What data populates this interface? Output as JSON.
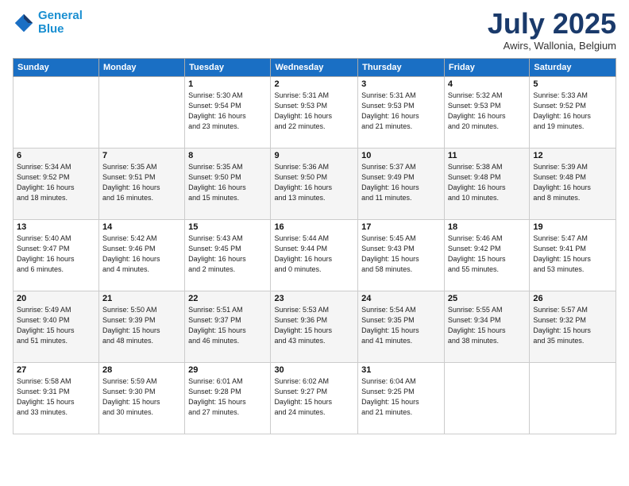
{
  "header": {
    "logo_line1": "General",
    "logo_line2": "Blue",
    "month": "July 2025",
    "location": "Awirs, Wallonia, Belgium"
  },
  "weekdays": [
    "Sunday",
    "Monday",
    "Tuesday",
    "Wednesday",
    "Thursday",
    "Friday",
    "Saturday"
  ],
  "weeks": [
    [
      {
        "day": "",
        "info": ""
      },
      {
        "day": "",
        "info": ""
      },
      {
        "day": "1",
        "info": "Sunrise: 5:30 AM\nSunset: 9:54 PM\nDaylight: 16 hours\nand 23 minutes."
      },
      {
        "day": "2",
        "info": "Sunrise: 5:31 AM\nSunset: 9:53 PM\nDaylight: 16 hours\nand 22 minutes."
      },
      {
        "day": "3",
        "info": "Sunrise: 5:31 AM\nSunset: 9:53 PM\nDaylight: 16 hours\nand 21 minutes."
      },
      {
        "day": "4",
        "info": "Sunrise: 5:32 AM\nSunset: 9:53 PM\nDaylight: 16 hours\nand 20 minutes."
      },
      {
        "day": "5",
        "info": "Sunrise: 5:33 AM\nSunset: 9:52 PM\nDaylight: 16 hours\nand 19 minutes."
      }
    ],
    [
      {
        "day": "6",
        "info": "Sunrise: 5:34 AM\nSunset: 9:52 PM\nDaylight: 16 hours\nand 18 minutes."
      },
      {
        "day": "7",
        "info": "Sunrise: 5:35 AM\nSunset: 9:51 PM\nDaylight: 16 hours\nand 16 minutes."
      },
      {
        "day": "8",
        "info": "Sunrise: 5:35 AM\nSunset: 9:50 PM\nDaylight: 16 hours\nand 15 minutes."
      },
      {
        "day": "9",
        "info": "Sunrise: 5:36 AM\nSunset: 9:50 PM\nDaylight: 16 hours\nand 13 minutes."
      },
      {
        "day": "10",
        "info": "Sunrise: 5:37 AM\nSunset: 9:49 PM\nDaylight: 16 hours\nand 11 minutes."
      },
      {
        "day": "11",
        "info": "Sunrise: 5:38 AM\nSunset: 9:48 PM\nDaylight: 16 hours\nand 10 minutes."
      },
      {
        "day": "12",
        "info": "Sunrise: 5:39 AM\nSunset: 9:48 PM\nDaylight: 16 hours\nand 8 minutes."
      }
    ],
    [
      {
        "day": "13",
        "info": "Sunrise: 5:40 AM\nSunset: 9:47 PM\nDaylight: 16 hours\nand 6 minutes."
      },
      {
        "day": "14",
        "info": "Sunrise: 5:42 AM\nSunset: 9:46 PM\nDaylight: 16 hours\nand 4 minutes."
      },
      {
        "day": "15",
        "info": "Sunrise: 5:43 AM\nSunset: 9:45 PM\nDaylight: 16 hours\nand 2 minutes."
      },
      {
        "day": "16",
        "info": "Sunrise: 5:44 AM\nSunset: 9:44 PM\nDaylight: 16 hours\nand 0 minutes."
      },
      {
        "day": "17",
        "info": "Sunrise: 5:45 AM\nSunset: 9:43 PM\nDaylight: 15 hours\nand 58 minutes."
      },
      {
        "day": "18",
        "info": "Sunrise: 5:46 AM\nSunset: 9:42 PM\nDaylight: 15 hours\nand 55 minutes."
      },
      {
        "day": "19",
        "info": "Sunrise: 5:47 AM\nSunset: 9:41 PM\nDaylight: 15 hours\nand 53 minutes."
      }
    ],
    [
      {
        "day": "20",
        "info": "Sunrise: 5:49 AM\nSunset: 9:40 PM\nDaylight: 15 hours\nand 51 minutes."
      },
      {
        "day": "21",
        "info": "Sunrise: 5:50 AM\nSunset: 9:39 PM\nDaylight: 15 hours\nand 48 minutes."
      },
      {
        "day": "22",
        "info": "Sunrise: 5:51 AM\nSunset: 9:37 PM\nDaylight: 15 hours\nand 46 minutes."
      },
      {
        "day": "23",
        "info": "Sunrise: 5:53 AM\nSunset: 9:36 PM\nDaylight: 15 hours\nand 43 minutes."
      },
      {
        "day": "24",
        "info": "Sunrise: 5:54 AM\nSunset: 9:35 PM\nDaylight: 15 hours\nand 41 minutes."
      },
      {
        "day": "25",
        "info": "Sunrise: 5:55 AM\nSunset: 9:34 PM\nDaylight: 15 hours\nand 38 minutes."
      },
      {
        "day": "26",
        "info": "Sunrise: 5:57 AM\nSunset: 9:32 PM\nDaylight: 15 hours\nand 35 minutes."
      }
    ],
    [
      {
        "day": "27",
        "info": "Sunrise: 5:58 AM\nSunset: 9:31 PM\nDaylight: 15 hours\nand 33 minutes."
      },
      {
        "day": "28",
        "info": "Sunrise: 5:59 AM\nSunset: 9:30 PM\nDaylight: 15 hours\nand 30 minutes."
      },
      {
        "day": "29",
        "info": "Sunrise: 6:01 AM\nSunset: 9:28 PM\nDaylight: 15 hours\nand 27 minutes."
      },
      {
        "day": "30",
        "info": "Sunrise: 6:02 AM\nSunset: 9:27 PM\nDaylight: 15 hours\nand 24 minutes."
      },
      {
        "day": "31",
        "info": "Sunrise: 6:04 AM\nSunset: 9:25 PM\nDaylight: 15 hours\nand 21 minutes."
      },
      {
        "day": "",
        "info": ""
      },
      {
        "day": "",
        "info": ""
      }
    ]
  ]
}
